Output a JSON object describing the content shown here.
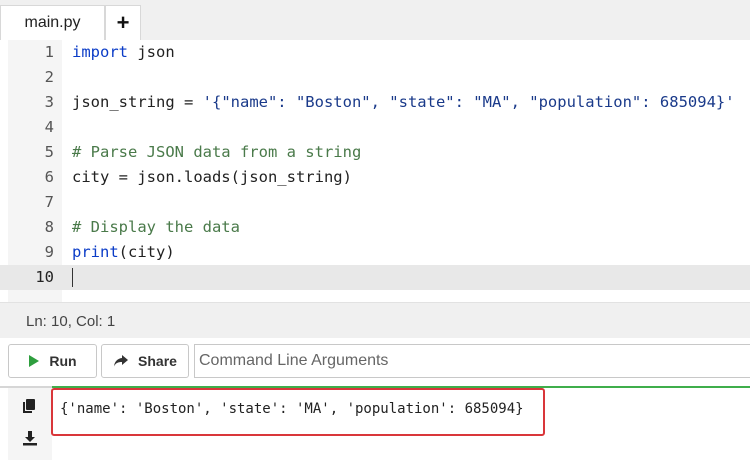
{
  "tabs": {
    "file": "main.py",
    "add": "+"
  },
  "editor": {
    "lines": [
      {
        "num": "1",
        "text": ""
      },
      {
        "num": "2",
        "text": ""
      },
      {
        "num": "3",
        "text": ""
      },
      {
        "num": "4",
        "text": ""
      },
      {
        "num": "5",
        "text": "# Parse JSON data from a string"
      },
      {
        "num": "6",
        "text": "city = json.loads(json_string)"
      },
      {
        "num": "7",
        "text": ""
      },
      {
        "num": "8",
        "text": ""
      },
      {
        "num": "9",
        "text": ""
      },
      {
        "num": "10",
        "text": ""
      }
    ],
    "tokens": {
      "import_kw": "import",
      "import_mod": " json",
      "line3_var": "json_string = ",
      "line3_str": "'{\"name\": \"Boston\", \"state\": \"MA\", \"population\": 685094}'",
      "line8_comment": "# Display the data",
      "line9_fn": "print",
      "line9_args": "(city)"
    }
  },
  "status": {
    "position": "Ln: 10,  Col: 1"
  },
  "toolbar": {
    "run_label": "Run",
    "share_label": "Share",
    "args_placeholder": "Command Line Arguments",
    "run_color": "#2e9e3e"
  },
  "output": {
    "text": "{'name': 'Boston', 'state': 'MA', 'population': 685094}",
    "highlight_color": "#d9363a",
    "accent_color": "#3fae4b"
  }
}
